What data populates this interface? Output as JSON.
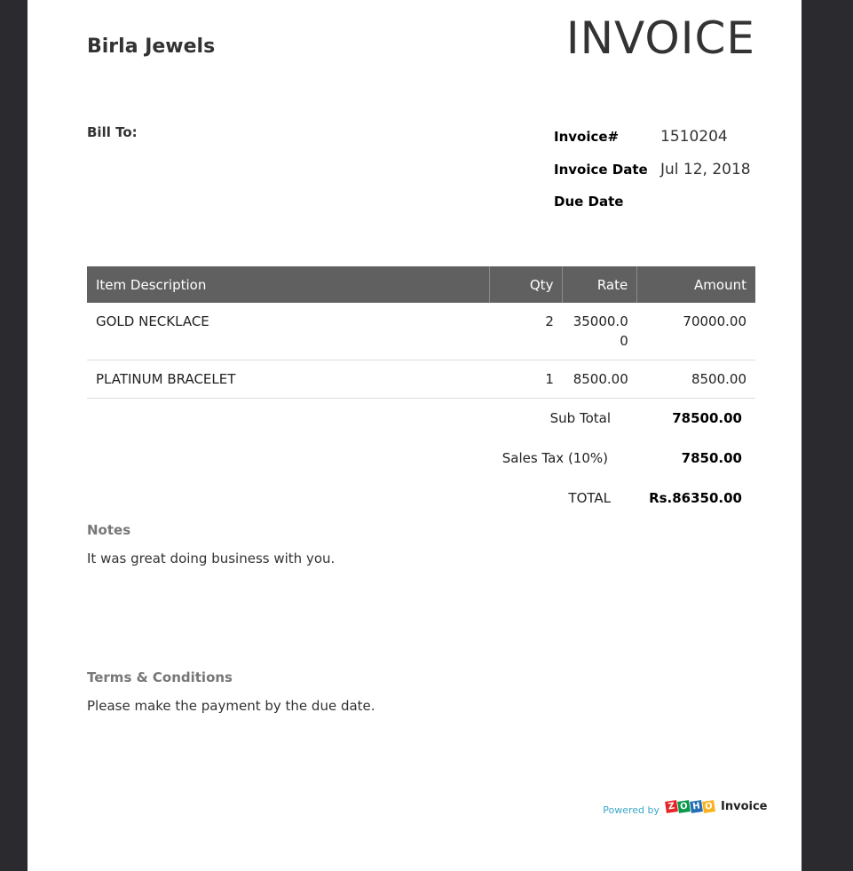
{
  "company_name": "Birla Jewels",
  "doc_title": "INVOICE",
  "bill_to_label": "Bill To:",
  "meta": {
    "invoice_no_label": "Invoice#",
    "invoice_no": "1510204",
    "invoice_date_label": "Invoice Date",
    "invoice_date": "Jul 12, 2018",
    "due_date_label": "Due Date"
  },
  "table": {
    "headers": [
      "Item Description",
      "Qty",
      "Rate",
      "Amount"
    ],
    "rows": [
      {
        "desc": "GOLD NECKLACE",
        "qty": "2",
        "rate": "35000.00",
        "amount": "70000.00"
      },
      {
        "desc": "PLATINUM BRACELET",
        "qty": "1",
        "rate": "8500.00",
        "amount": "8500.00"
      }
    ]
  },
  "totals": {
    "subtotal_label": "Sub Total",
    "subtotal": "78500.00",
    "tax_label": "Sales Tax (10%)",
    "tax": "7850.00",
    "total_label": "TOTAL",
    "total": "Rs.86350.00"
  },
  "notes": {
    "heading": "Notes",
    "text": "It was great doing business with you."
  },
  "terms": {
    "heading": "Terms & Conditions",
    "text": "Please make the payment by the due date."
  },
  "footer": {
    "powered_by": "Powered by",
    "brand_letters": [
      "Z",
      "O",
      "H",
      "O"
    ],
    "brand_word": "Invoice",
    "brand_colors": [
      "#e42527",
      "#089949",
      "#226db4",
      "#f9b21d"
    ]
  }
}
